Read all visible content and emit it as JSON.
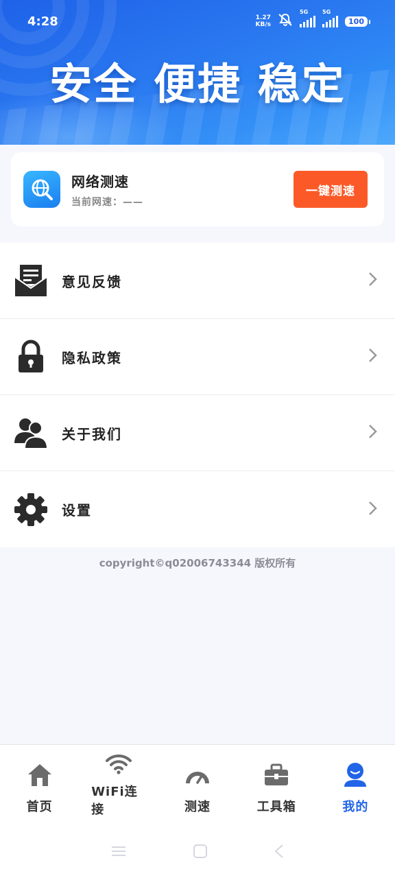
{
  "status_bar": {
    "time": "4:28",
    "net_speed_value": "1.27",
    "net_speed_unit": "KB/s",
    "sim1_label": "5G",
    "sim2_label": "5G",
    "battery": "100"
  },
  "banner": {
    "slogan": "安全 便捷 稳定"
  },
  "speed_card": {
    "title": "网络测速",
    "subtitle": "当前网速：——",
    "button_label": "一键测速"
  },
  "menu": {
    "items": [
      {
        "label": "意见反馈",
        "icon": "feedback-mail-icon"
      },
      {
        "label": "隐私政策",
        "icon": "lock-icon"
      },
      {
        "label": "关于我们",
        "icon": "users-icon"
      },
      {
        "label": "设置",
        "icon": "gear-icon"
      }
    ]
  },
  "footer": {
    "copyright": "copyright©q02006743344 版权所有"
  },
  "tabbar": {
    "tabs": [
      {
        "label": "首页",
        "icon": "home-icon"
      },
      {
        "label": "WiFi连接",
        "icon": "wifi-icon"
      },
      {
        "label": "测速",
        "icon": "speedometer-icon"
      },
      {
        "label": "工具箱",
        "icon": "toolbox-icon"
      },
      {
        "label": "我的",
        "icon": "user-icon"
      }
    ],
    "active_index": 4,
    "active_color": "#2164e8"
  },
  "colors": {
    "banner_blue": "#1e62e8",
    "accent_orange": "#fb5a28"
  }
}
